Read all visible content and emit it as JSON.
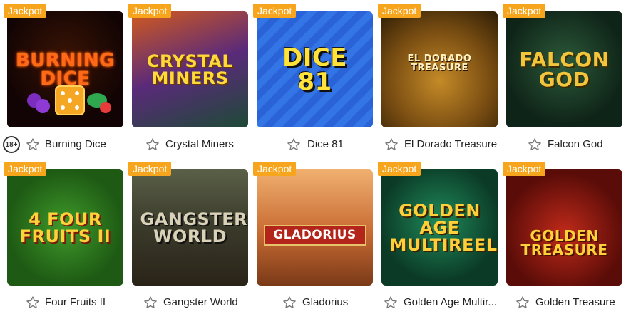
{
  "badge_label": "Jackpot",
  "age_badge": "18+",
  "colors": {
    "badge": "#f7a51c",
    "name_text": "#222222"
  },
  "games": [
    {
      "name": "Burning Dice",
      "art_title": "BURNING DICE"
    },
    {
      "name": "Crystal Miners",
      "art_title": "Crystal MINERS"
    },
    {
      "name": "Dice 81",
      "art_title": "DICE 81"
    },
    {
      "name": "El Dorado Treasure",
      "art_title": "EL DORADO TREASURE"
    },
    {
      "name": "Falcon God",
      "art_title": "FALCON GOD"
    },
    {
      "name": "Four Fruits II",
      "art_title": "4 FOUR fruits II"
    },
    {
      "name": "Gangster World",
      "art_title": "GANGSTER WORLD"
    },
    {
      "name": "Gladorius",
      "art_title": "GLADORIUS"
    },
    {
      "name": "Golden Age Multir...",
      "art_title": "GOLDEN AGE MULTIREELS"
    },
    {
      "name": "Golden Treasure",
      "art_title": "GOLDEN TREASURE"
    }
  ]
}
